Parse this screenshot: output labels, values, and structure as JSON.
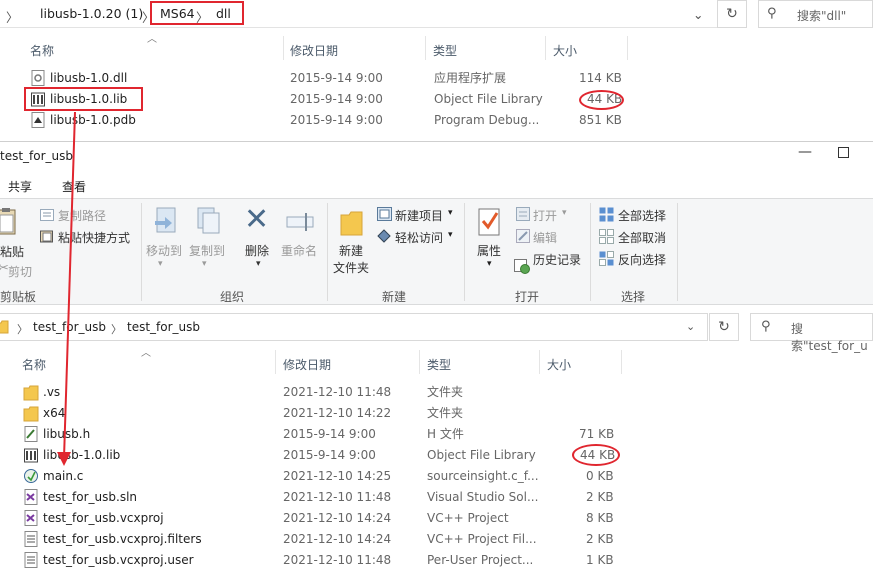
{
  "top_window": {
    "breadcrumb": [
      "libusb-1.0.20 (1)",
      "MS64",
      "dll"
    ],
    "search_placeholder": "搜索\"dll\"",
    "columns": [
      "名称",
      "修改日期",
      "类型",
      "大小"
    ],
    "files": [
      {
        "name": "libusb-1.0.dll",
        "date": "2015-9-14 9:00",
        "type": "应用程序扩展",
        "size": "114 KB",
        "icon": "dll-icon"
      },
      {
        "name": "libusb-1.0.lib",
        "date": "2015-9-14 9:00",
        "type": "Object File Library",
        "size": "44 KB",
        "icon": "lib-icon"
      },
      {
        "name": "libusb-1.0.pdb",
        "date": "2015-9-14 9:00",
        "type": "Program Debug...",
        "size": "851 KB",
        "icon": "pdb-icon"
      }
    ]
  },
  "bottom_window": {
    "title": "test_for_usb",
    "ribbon_tabs": [
      "共享",
      "查看"
    ],
    "ribbon": {
      "paste": "粘贴",
      "copy_path": "复制路径",
      "paste_shortcut": "粘贴快捷方式",
      "cut": "剪切",
      "clipboard": "剪贴板",
      "move_to": "移动到",
      "copy_to": "复制到",
      "delete": "删除",
      "rename": "重命名",
      "organize": "组织",
      "new_item": "新建项目",
      "easy_access": "轻松访问",
      "new_folder_line1": "新建",
      "new_folder_line2": "文件夹",
      "new_group": "新建",
      "properties": "属性",
      "open": "打开",
      "edit": "编辑",
      "history": "历史记录",
      "open_group": "打开",
      "select_all": "全部选择",
      "select_none": "全部取消",
      "invert": "反向选择",
      "select_group": "选择"
    },
    "breadcrumb": [
      "test_for_usb",
      "test_for_usb"
    ],
    "search_placeholder": "搜索\"test_for_u",
    "columns": [
      "名称",
      "修改日期",
      "类型",
      "大小"
    ],
    "files": [
      {
        "name": ".vs",
        "date": "2021-12-10 11:48",
        "type": "文件夹",
        "size": "",
        "icon": "folder-icon"
      },
      {
        "name": "x64",
        "date": "2021-12-10 14:22",
        "type": "文件夹",
        "size": "",
        "icon": "folder-icon"
      },
      {
        "name": "libusb.h",
        "date": "2015-9-14 9:00",
        "type": "H 文件",
        "size": "71 KB",
        "icon": "header-file-icon"
      },
      {
        "name": "libusb-1.0.lib",
        "date": "2015-9-14 9:00",
        "type": "Object File Library",
        "size": "44 KB",
        "icon": "lib-icon"
      },
      {
        "name": "main.c",
        "date": "2021-12-10 14:25",
        "type": "sourceinsight.c_f...",
        "size": "0 KB",
        "icon": "c-file-icon"
      },
      {
        "name": "test_for_usb.sln",
        "date": "2021-12-10 11:48",
        "type": "Visual Studio Sol...",
        "size": "2 KB",
        "icon": "sln-icon"
      },
      {
        "name": "test_for_usb.vcxproj",
        "date": "2021-12-10 14:24",
        "type": "VC++ Project",
        "size": "8 KB",
        "icon": "vcxproj-icon"
      },
      {
        "name": "test_for_usb.vcxproj.filters",
        "date": "2021-12-10 14:24",
        "type": "VC++ Project Fil...",
        "size": "2 KB",
        "icon": "filters-icon"
      },
      {
        "name": "test_for_usb.vcxproj.user",
        "date": "2021-12-10 11:48",
        "type": "Per-User Project...",
        "size": "1 KB",
        "icon": "user-file-icon"
      }
    ]
  },
  "colors": {
    "annotation_red": "#e0262f",
    "ribbon_blue": "#2f6db5",
    "folder_yellow": "#f4c74e"
  }
}
